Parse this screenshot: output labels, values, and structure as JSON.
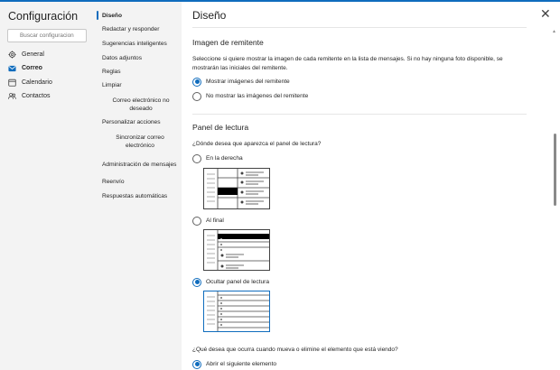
{
  "app": {
    "title": "Configuración",
    "search_placeholder": "Buscar configuracion"
  },
  "nav_primary": [
    {
      "label": "General",
      "icon": "gear-icon"
    },
    {
      "label": "Correo",
      "icon": "mail-icon",
      "active": true
    },
    {
      "label": "Calendario",
      "icon": "calendar-icon"
    },
    {
      "label": "Contactos",
      "icon": "people-icon"
    }
  ],
  "nav_secondary": {
    "diseno": "Diseño",
    "redactar": "Redactar y responder",
    "sugerencias": "Sugerencias inteligentes",
    "adjuntos": "Datos adjuntos",
    "reglas": "Reglas",
    "limpiar": "Limpiar",
    "no_deseado": "Correo electrónico no deseado",
    "personalizar": "Personalizar acciones",
    "sincronizar": "Sincronizar correo electrónico",
    "administracion": "Administración de mensajes",
    "reenvio": "Reenvío",
    "automaticas": "Respuestas automáticas"
  },
  "main": {
    "title": "Diseño",
    "sender_image": {
      "heading": "Imagen de remitente",
      "description": "Seleccione si quiere mostrar la imagen de cada remitente en la lista de mensajes. Si no hay ninguna foto disponible, se mostrarán las iniciales del remitente.",
      "option_show": "Mostrar imágenes del remitente",
      "option_hide": "No mostrar las imágenes del remitente",
      "selected": "show"
    },
    "reading_pane": {
      "heading": "Panel de lectura",
      "question": "¿Dónde desea que aparezca el panel de lectura?",
      "option_right": "En la derecha",
      "option_bottom": "Al final",
      "option_hide": "Ocultar panel de lectura",
      "selected": "hide"
    },
    "after_move": {
      "question": "¿Qué desea que ocurra cuando mueva o elimine el elemento que está viendo?",
      "option_next": "Abrir el siguiente elemento"
    }
  },
  "colors": {
    "accent": "#0f6cbd",
    "sidebar": "#f3f3f3"
  }
}
